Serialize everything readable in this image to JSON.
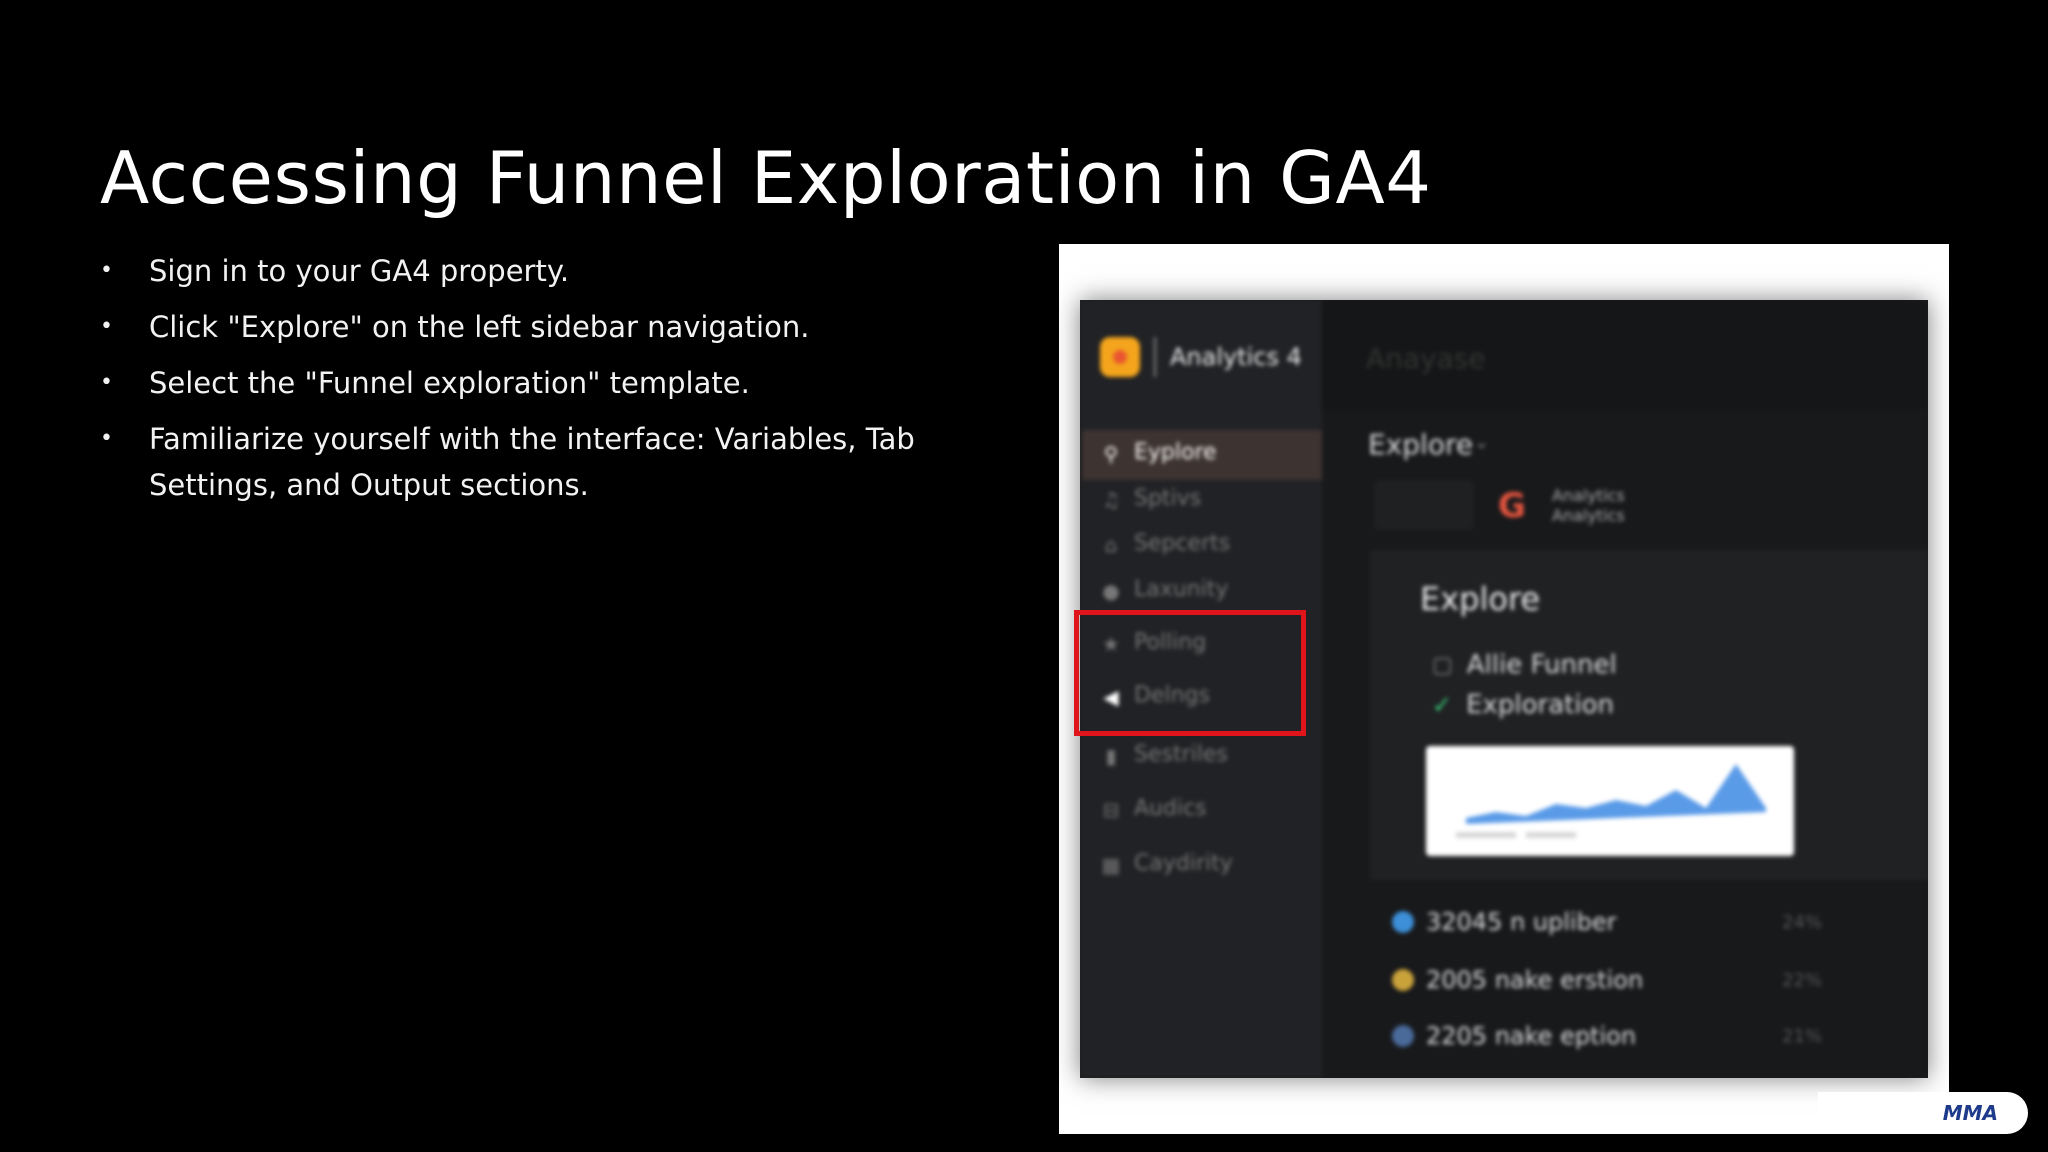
{
  "slide": {
    "title": "Accessing Funnel Exploration in GA4",
    "bullets": [
      "Sign in to your GA4 property.",
      "Click \"Explore\" on the left sidebar navigation.",
      "Select the \"Funnel exploration\" template.",
      "Familiarize yourself with the interface: Variables, Tab Settings, and Output sections."
    ]
  },
  "screenshot": {
    "brand": "Analytics 4",
    "nav": [
      {
        "label": "Eyplore",
        "icon": "magnifier-icon",
        "active": true
      },
      {
        "label": "Sptivs",
        "icon": "bell-icon"
      },
      {
        "label": "Sepcerts",
        "icon": "home-icon"
      },
      {
        "label": "Laxunity",
        "icon": "info-icon"
      },
      {
        "label": "Polling",
        "icon": "star-icon"
      },
      {
        "label": "Delngs",
        "icon": "megaphone-icon"
      },
      {
        "label": "Sestriles",
        "icon": "bar-icon"
      },
      {
        "label": "Audics",
        "icon": "car-icon"
      },
      {
        "label": "Caydirity",
        "icon": "grid-icon"
      }
    ],
    "ghost_title": "Anayase",
    "explore_tab": "Explore",
    "tile_text_1": "Analytics",
    "tile_text_2": "Analytics",
    "card_title": "Explore",
    "option_1": "Allie Funnel",
    "option_2": "Exploration",
    "stats": [
      {
        "label": "32045 n upliber",
        "pct": "24%"
      },
      {
        "label": "2005 nake erstion",
        "pct": "22%"
      },
      {
        "label": "2205 nake eption",
        "pct": "21%"
      }
    ],
    "colors": {
      "highlight": "#e0151b",
      "accent": "#f4a51c",
      "check": "#39d07a"
    }
  },
  "badge": {
    "text": "MMA"
  }
}
